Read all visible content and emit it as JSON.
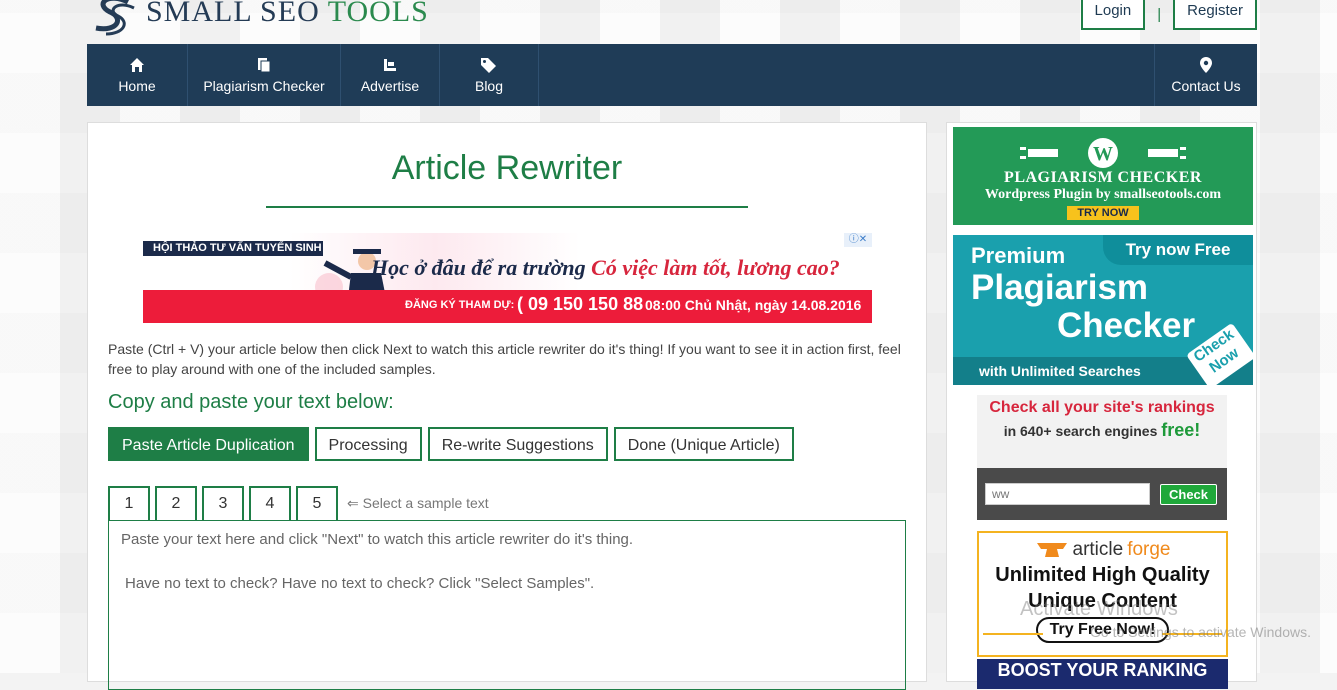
{
  "header": {
    "logo_text_a": "SMALL SEO ",
    "logo_text_b": "TOOLS",
    "login": "Login",
    "separator": "|",
    "register": "Register"
  },
  "nav": {
    "items": [
      {
        "label": "Home",
        "icon": "home-icon"
      },
      {
        "label": "Plagiarism Checker",
        "icon": "documents-icon"
      },
      {
        "label": "Advertise",
        "icon": "advertise-icon"
      },
      {
        "label": "Blog",
        "icon": "tags-icon"
      }
    ],
    "contact": {
      "label": "Contact Us",
      "icon": "map-marker-icon"
    }
  },
  "main": {
    "title": "Article Rewriter",
    "ad": {
      "top_label": "HỘI THẢO TƯ VẤN TUYỂN SINH",
      "headline_a": "Học ở đâu để ra trường ",
      "headline_b": "Có việc làm tốt, lương cao?",
      "register_label": "ĐĂNG KÝ THAM DỰ:",
      "phone": "( 09 150 150 88",
      "date": "08:00 Chủ Nhật, ngày 14.08.2016",
      "adchoice": "ⓘ✕"
    },
    "intro": "Paste (Ctrl + V) your article below then click Next to watch this article rewriter do it's thing! If you want to see it in action first, feel free to play around with one of the included samples.",
    "copy_heading": "Copy and paste your text below:",
    "steps": [
      "Paste Article Duplication",
      "Processing",
      "Re-write Suggestions",
      "Done (Unique Article)"
    ],
    "samples": [
      "1",
      "2",
      "3",
      "4",
      "5"
    ],
    "sample_hint": "⇐ Select a sample text",
    "textarea_line1": "Paste your text here and click \"Next\" to watch this article rewriter do it's thing.",
    "textarea_line2": "Have no text to check? Have no text to check? Click \"Select Samples\"."
  },
  "sidebar": {
    "wp": {
      "title": "PLAGIARISM CHECKER",
      "subtitle": "Wordpress Plugin by smallseotools.com",
      "try": "TRY NOW"
    },
    "premium": {
      "try_free": "Try now Free",
      "premium": "Premium",
      "plagiarism": "Plagiarism",
      "checker": "Checker",
      "unlimited": "with Unlimited Searches",
      "check_now": "Check Now"
    },
    "rank": {
      "line1": "Check all your site's rankings",
      "line2": "in 640+ search engines ",
      "free": "free!",
      "input_value": "ww",
      "check": "Check"
    },
    "articleforge": {
      "brand_a": "article",
      "brand_b": "forge",
      "line1": "Unlimited High Quality",
      "line2": "Unique Content",
      "button": "Try Free Now!"
    },
    "boost": "BOOST YOUR RANKING"
  },
  "overlay": {
    "watermark_a": "Activate Windows",
    "watermark_b": "Go to Settings to activate Windows."
  },
  "colors": {
    "nav_bg": "#1f3c57",
    "accent_green": "#1e7e46",
    "body_bg": "#f3f3f3"
  }
}
